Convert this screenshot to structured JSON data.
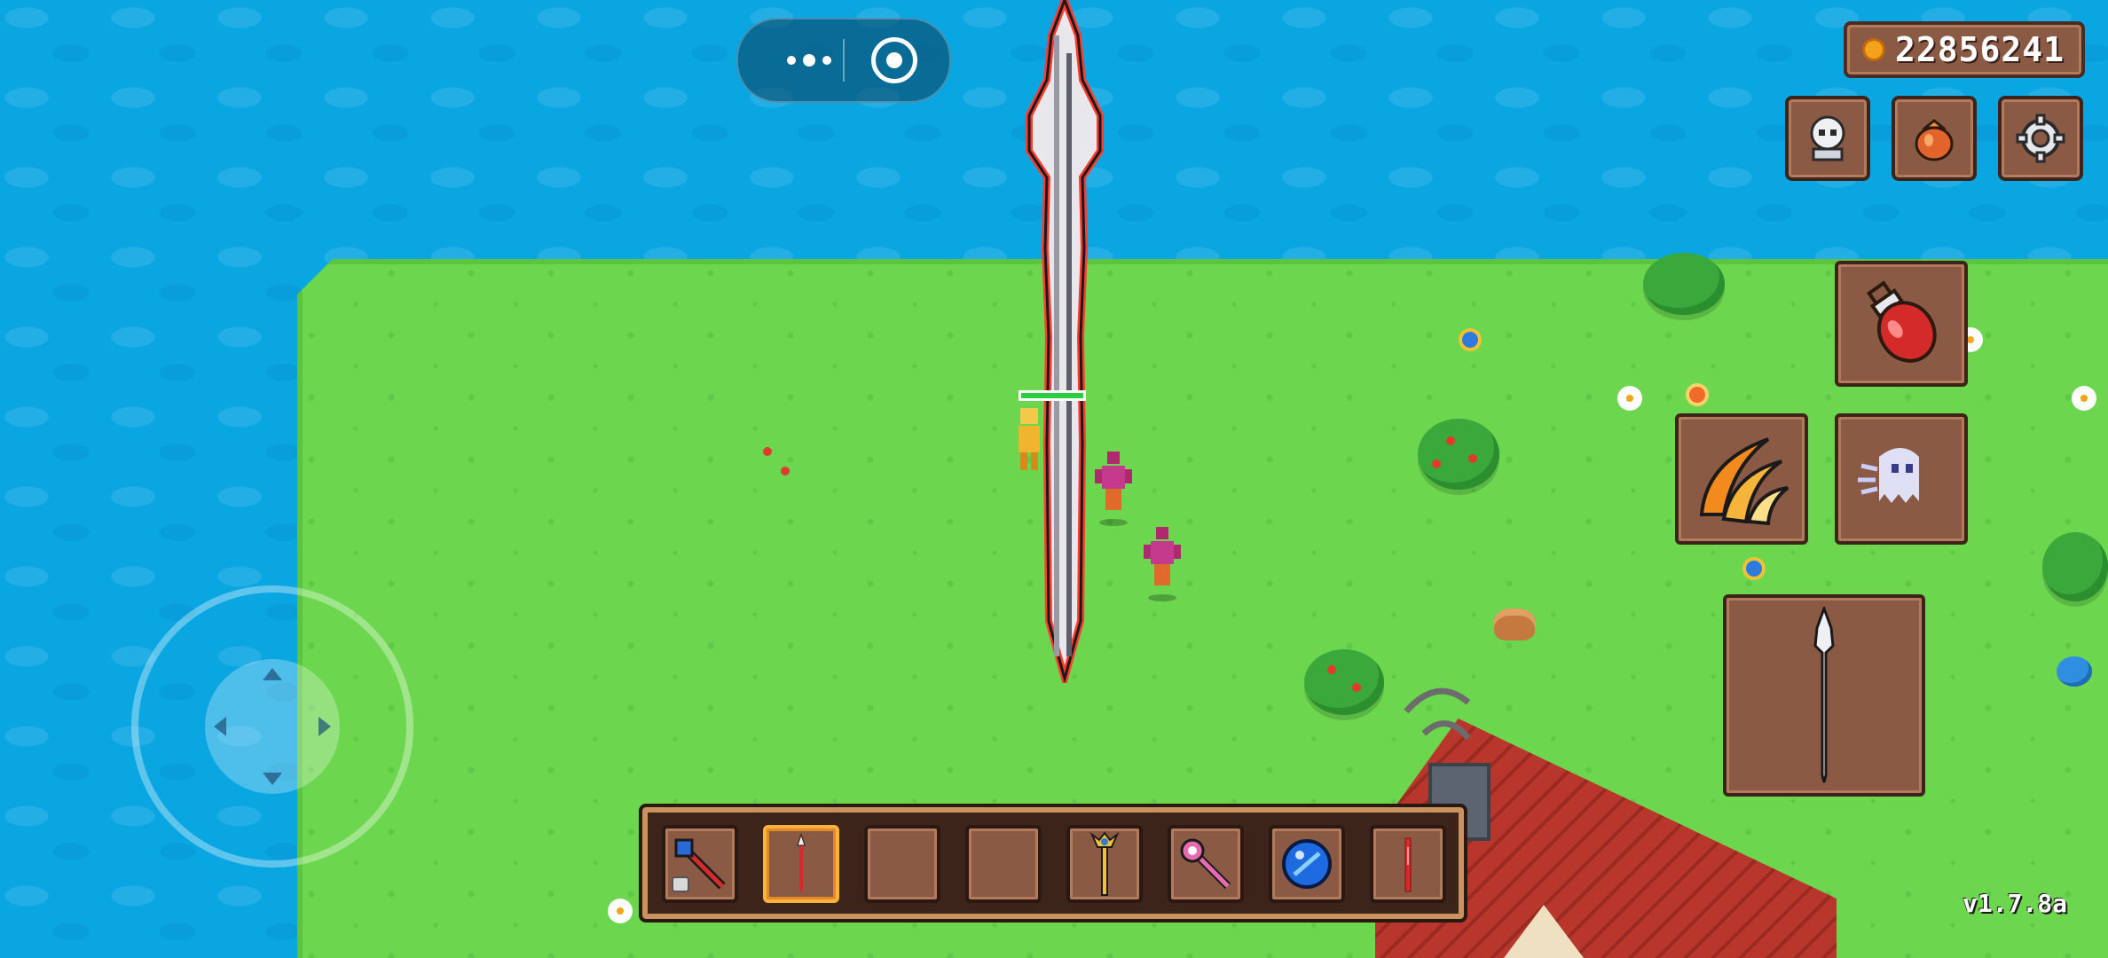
{
  "hud": {
    "coins": "22856241",
    "version": "v1.7.8a"
  },
  "top_buttons": [
    {
      "name": "character-menu-button",
      "icon": "skull-helmet-icon"
    },
    {
      "name": "inventory-bag-button",
      "icon": "loot-bag-icon"
    },
    {
      "name": "settings-button",
      "icon": "gear-icon"
    }
  ],
  "abilities": [
    {
      "name": "health-potion-slot",
      "icon": "red-potion-icon"
    },
    {
      "name": "fire-slash-skill",
      "icon": "fire-claw-icon"
    },
    {
      "name": "ghost-dash-skill",
      "icon": "ghost-icon"
    },
    {
      "name": "equipped-weapon-slot",
      "icon": "spear-icon"
    }
  ],
  "hotbar": [
    {
      "name": "hotbar-slot-1",
      "icon": "dark-staff-icon",
      "locked": true
    },
    {
      "name": "hotbar-slot-2",
      "icon": "red-spear-icon",
      "selected": true
    },
    {
      "name": "hotbar-slot-3",
      "icon": ""
    },
    {
      "name": "hotbar-slot-4",
      "icon": ""
    },
    {
      "name": "hotbar-slot-5",
      "icon": "golden-scepter-icon"
    },
    {
      "name": "hotbar-slot-6",
      "icon": "pink-wand-icon"
    },
    {
      "name": "hotbar-slot-7",
      "icon": "blue-orb-icon"
    },
    {
      "name": "hotbar-slot-8",
      "icon": "red-blade-icon"
    }
  ],
  "colors": {
    "water": "#0aa6e2",
    "grass": "#6dd64f",
    "panel": "#8a5a44",
    "panel_border": "#3c241b",
    "health": "#2ecc40"
  }
}
